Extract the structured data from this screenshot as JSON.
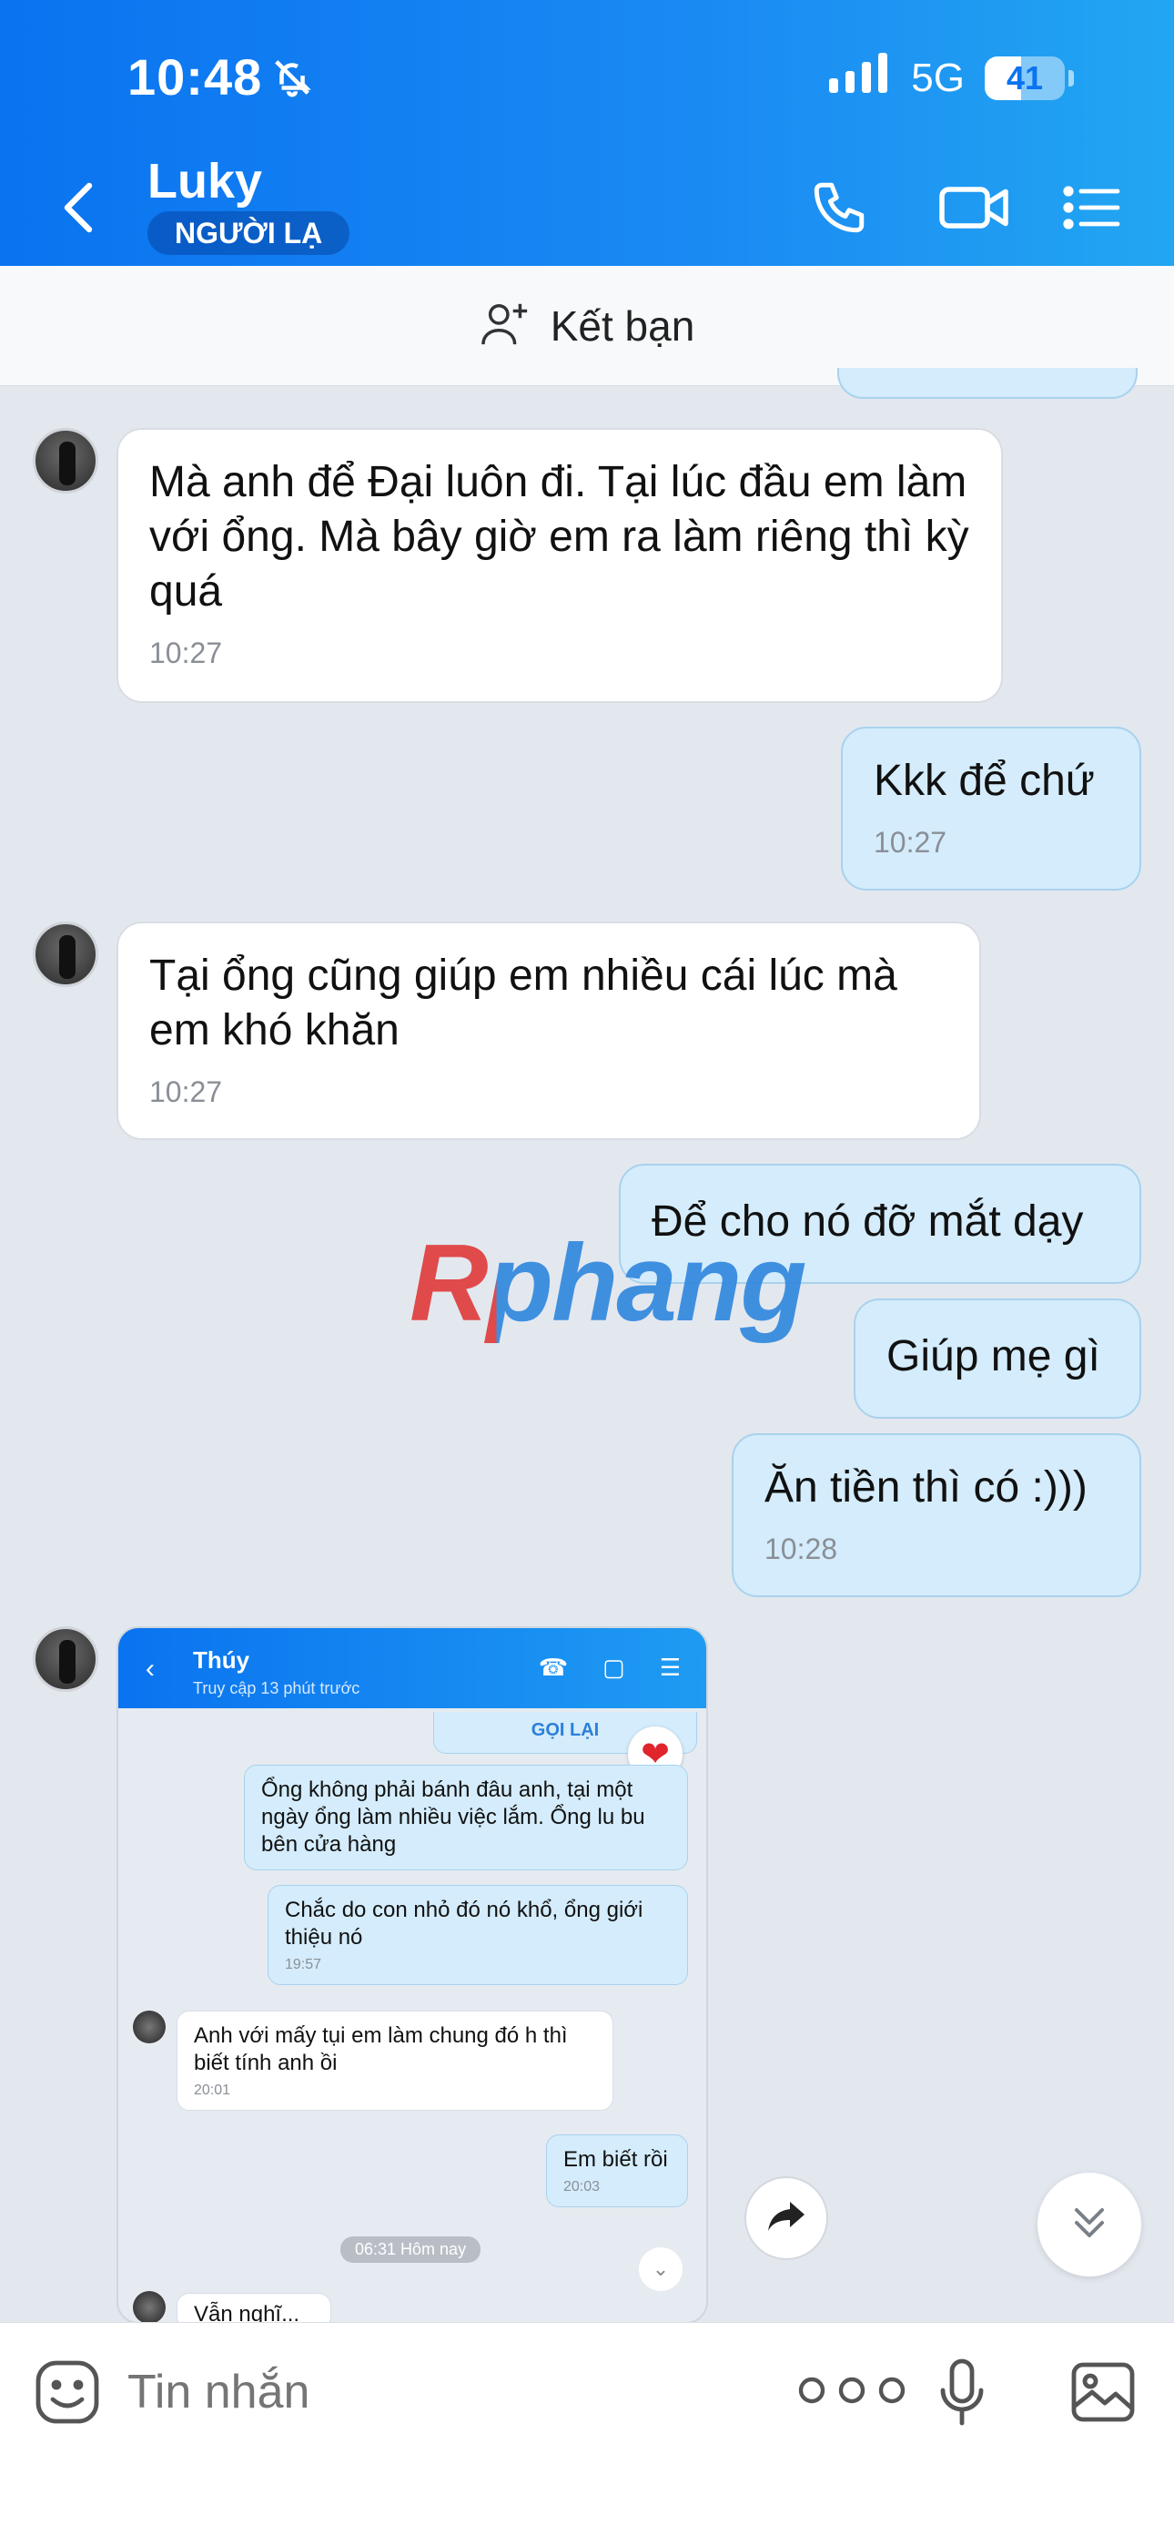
{
  "status_bar": {
    "time": "10:48",
    "network": "5G",
    "battery": "41"
  },
  "header": {
    "contact_name": "Luky",
    "badge": "NGƯỜI LẠ",
    "icons": [
      "back-icon",
      "phone-icon",
      "video-icon",
      "menu-list-icon"
    ]
  },
  "add_friend": {
    "label": "Kết bạn",
    "icon": "add-person-icon"
  },
  "messages": [
    {
      "dir": "in",
      "text": "Mà anh để Đại luôn đi. Tại lúc đầu em làm với ổng. Mà bây giờ em ra làm riêng thì kỳ quá",
      "time": "10:27"
    },
    {
      "dir": "out",
      "text": "Kkk để chứ",
      "time": "10:27"
    },
    {
      "dir": "in",
      "text": "Tại ổng cũng giúp em nhiều cái lúc mà em khó khăn",
      "time": "10:27"
    },
    {
      "dir": "out",
      "text": "Để cho nó đỡ mắt dạy",
      "time": ""
    },
    {
      "dir": "out",
      "text": "Giúp mẹ gì",
      "time": ""
    },
    {
      "dir": "out",
      "text": "Ăn tiền thì có :)))",
      "time": "10:28"
    }
  ],
  "watermark": "Rphang",
  "shared_screenshot": {
    "contact_name": "Thúy",
    "subtitle": "Truy cập 13 phút trước",
    "callback_label": "GỌI LẠI",
    "messages": [
      {
        "dir": "out",
        "text": "Ổng không phải bánh đâu anh, tại một ngày ổng làm nhiều việc lắm. Ổng lu bu bên cửa hàng",
        "time": ""
      },
      {
        "dir": "out",
        "text": "Chắc do con nhỏ đó nó khổ, ổng giới thiệu nó",
        "time": "19:57"
      },
      {
        "dir": "in",
        "text": "Anh với mấy tụi em làm chung đó h thì biết tính anh ồi",
        "time": "20:01"
      },
      {
        "dir": "out",
        "text": "Em biết rồi",
        "time": "20:03"
      }
    ],
    "separator": "06:31 Hôm nay",
    "partial_text": "Vẫn nghĩ..."
  },
  "input": {
    "placeholder": "Tin nhắn"
  },
  "colors": {
    "header_start": "#0a73f0",
    "header_end": "#22a6f2",
    "out_bubble": "#d4ecfb",
    "in_bubble": "#ffffff",
    "background": "#e3e8ef"
  }
}
